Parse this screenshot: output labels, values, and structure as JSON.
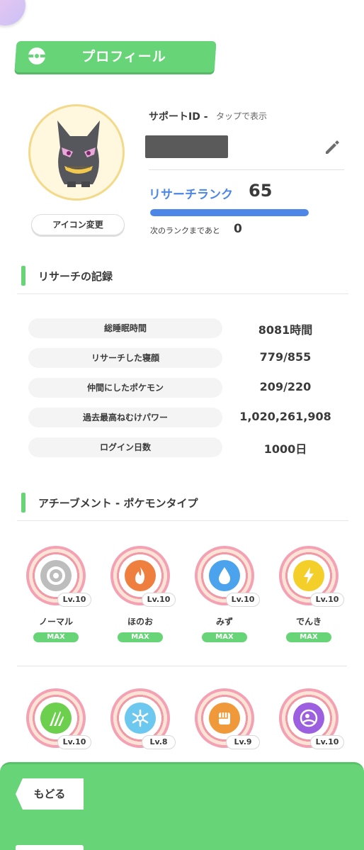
{
  "header": {
    "title": "プロフィール"
  },
  "profile": {
    "change_icon_label": "アイコン変更",
    "support_id_label": "サポートID -",
    "support_id_tap": "タップで表示",
    "rank_label": "リサーチランク",
    "rank_value": "65",
    "rank_progress": 1.0,
    "next_rank_label": "次のランクまであと",
    "next_rank_value": "0"
  },
  "records": {
    "title": "リサーチの記録",
    "items": [
      {
        "label": "総睡眠時間",
        "value": "8081時間"
      },
      {
        "label": "リサーチした寝顔",
        "value": "779/855"
      },
      {
        "label": "仲間にしたポケモン",
        "value": "209/220"
      },
      {
        "label": "過去最高ねむけパワー",
        "value": "1,020,261,908"
      },
      {
        "label": "ログイン日数",
        "value": "1000日"
      }
    ]
  },
  "achievements": {
    "title": "アチーブメント - ポケモンタイプ",
    "row1": [
      {
        "name": "ノーマル",
        "level": "Lv.10",
        "status": "MAX",
        "icon": "normal-type-icon",
        "color": "#bdbdbd"
      },
      {
        "name": "ほのお",
        "level": "Lv.10",
        "status": "MAX",
        "icon": "fire-type-icon",
        "color": "#ef7f3e"
      },
      {
        "name": "みず",
        "level": "Lv.10",
        "status": "MAX",
        "icon": "water-type-icon",
        "color": "#4aa3ec"
      },
      {
        "name": "でんき",
        "level": "Lv.10",
        "status": "MAX",
        "icon": "electric-type-icon",
        "color": "#f4cf2a"
      }
    ],
    "row2": [
      {
        "level": "Lv.10",
        "icon": "grass-type-icon",
        "color": "#6ccf4e"
      },
      {
        "level": "Lv.8",
        "icon": "ice-type-icon",
        "color": "#6cc8ef"
      },
      {
        "level": "Lv.9",
        "icon": "fighting-type-icon",
        "color": "#f0993a"
      },
      {
        "level": "Lv.10",
        "icon": "psychic-type-icon",
        "color": "#9c5fe0"
      }
    ]
  },
  "footer": {
    "back_label": "もどる"
  }
}
